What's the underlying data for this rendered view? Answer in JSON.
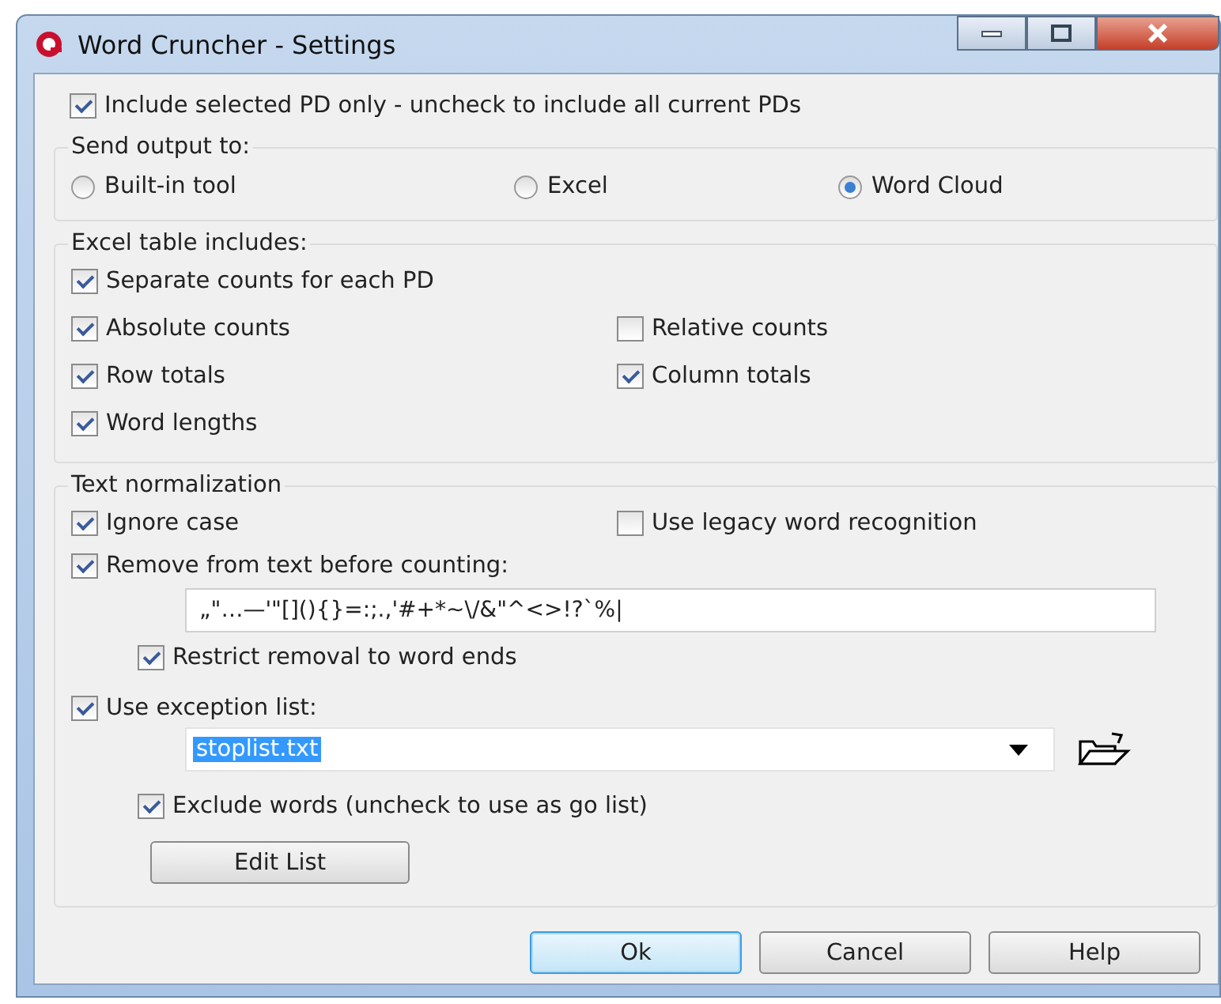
{
  "window": {
    "title": "Word Cruncher - Settings"
  },
  "include_selected": {
    "label": "Include selected PD only - uncheck to include all current PDs",
    "checked": true
  },
  "send_output": {
    "title": "Send output to:",
    "options": [
      {
        "label": "Built-in tool",
        "selected": false
      },
      {
        "label": "Excel",
        "selected": false
      },
      {
        "label": "Word Cloud",
        "selected": true
      }
    ]
  },
  "excel_table": {
    "title": "Excel table includes:",
    "rows": [
      [
        {
          "label": "Separate counts for each PD",
          "checked": true
        }
      ],
      [
        {
          "label": "Absolute counts",
          "checked": true
        },
        {
          "label": "Relative counts",
          "checked": false
        }
      ],
      [
        {
          "label": "Row totals",
          "checked": true
        },
        {
          "label": "Column totals",
          "checked": true
        }
      ],
      [
        {
          "label": "Word lengths",
          "checked": true
        }
      ]
    ]
  },
  "text_normalization": {
    "title": "Text normalization",
    "ignore_case": {
      "label": "Ignore case",
      "checked": true
    },
    "legacy": {
      "label": "Use legacy word recognition",
      "checked": false
    },
    "remove": {
      "label": "Remove from text before counting:",
      "checked": true,
      "value": "„\"…—'\"[](){}=:;.,'#+*~\\/&\"^<>!?`%|"
    },
    "restrict": {
      "label": "Restrict removal to word ends",
      "checked": true
    },
    "exception": {
      "label": "Use exception list:",
      "checked": true,
      "value": "stoplist.txt"
    },
    "exclude": {
      "label": "Exclude words (uncheck to use as go list)",
      "checked": true
    },
    "edit_button": "Edit List"
  },
  "buttons": [
    {
      "label": "Ok",
      "default": true
    },
    {
      "label": "Cancel",
      "default": false
    },
    {
      "label": "Help",
      "default": false
    }
  ]
}
